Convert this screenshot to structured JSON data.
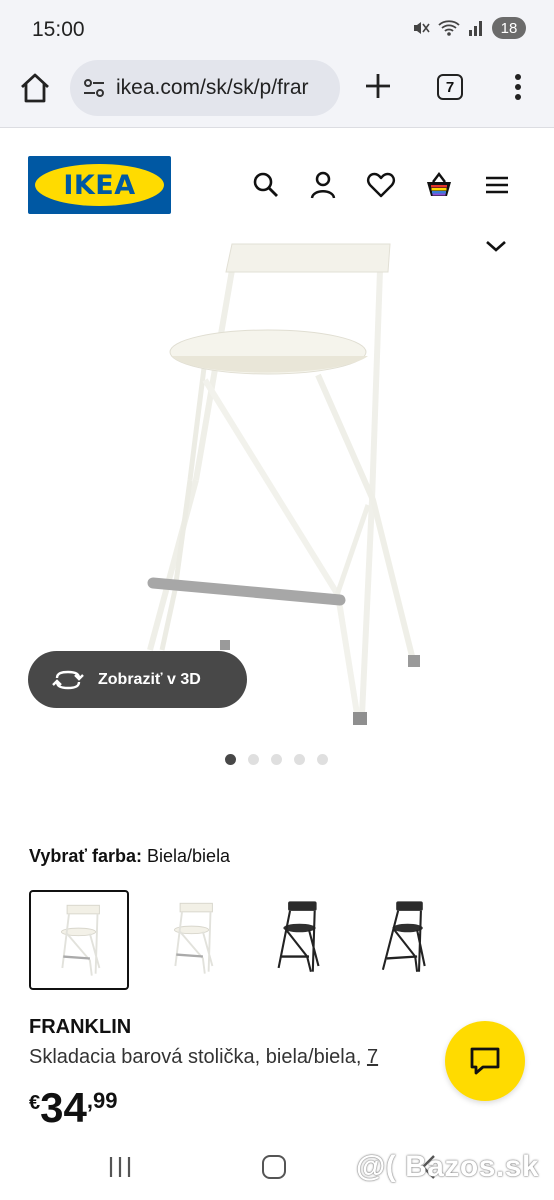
{
  "status_bar": {
    "time": "15:00",
    "battery": "18",
    "icons": [
      "mute-icon",
      "wifi-icon",
      "signal-icon"
    ]
  },
  "browser": {
    "url": "ikea.com/sk/sk/p/frar",
    "tab_count": "7"
  },
  "header": {
    "logo_text": "IKEA",
    "icons": [
      "search-icon",
      "account-icon",
      "heart-icon",
      "basket-icon",
      "hamburger-menu-icon"
    ]
  },
  "gallery": {
    "view_3d_label": "Zobraziť v 3D",
    "dot_count": 5,
    "active_dot": 1
  },
  "color_select": {
    "label": "Vybrať farba:",
    "value": "Biela/biela",
    "swatches": [
      "white-chair-1",
      "white-chair-2",
      "black-chair-1",
      "black-chair-2"
    ],
    "selected_index": 0
  },
  "product": {
    "name": "FRANKLIN",
    "description": "Skladacia barová stolička, biela/biela, ",
    "description_link": "7",
    "currency": "€",
    "price_int": "34",
    "price_dec": ",99"
  },
  "watermark": "@( Bazos.sk",
  "colors": {
    "ikea_blue": "#0058a3",
    "ikea_yellow": "#ffdb00",
    "dark_button": "#484848"
  }
}
